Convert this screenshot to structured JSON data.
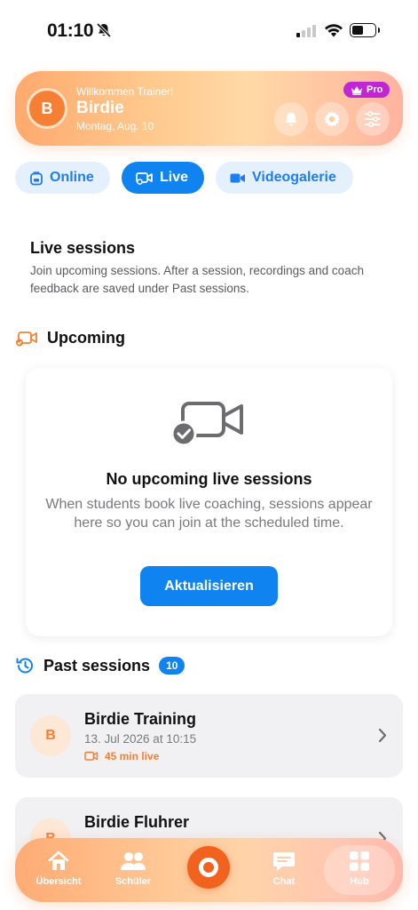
{
  "status_bar": {
    "time": "01:10"
  },
  "header": {
    "avatar_letter": "B",
    "welcome": "Willkommen Trainer!",
    "name": "Birdie",
    "date": "Montag, Aug. 10",
    "pro_badge": "Pro"
  },
  "tabs": [
    {
      "label": "Online",
      "active": false
    },
    {
      "label": "Live",
      "active": true
    },
    {
      "label": "Videogalerie",
      "active": false
    }
  ],
  "live_sessions": {
    "title": "Live sessions",
    "description": "Join upcoming sessions. After a session, recordings and coach feedback are saved under Past sessions."
  },
  "upcoming": {
    "title": "Upcoming",
    "empty_title": "No upcoming live sessions",
    "empty_desc": "When students book live coaching, sessions appear here so you can join at the scheduled time.",
    "refresh_label": "Aktualisieren"
  },
  "past": {
    "title": "Past sessions",
    "count": "10",
    "items": [
      {
        "avatar": "B",
        "title": "Birdie Training",
        "date": "13. Jul 2026 at 10:15",
        "live": "45 min live"
      },
      {
        "avatar": "B",
        "title": "Birdie Fluhrer"
      }
    ]
  },
  "bottom_nav": [
    {
      "label": "Übersicht",
      "icon": "home-icon"
    },
    {
      "label": "Schüler",
      "icon": "people-icon"
    },
    {
      "label": "",
      "icon": "record-icon"
    },
    {
      "label": "Chat",
      "icon": "chat-icon"
    },
    {
      "label": "Hub",
      "icon": "grid-icon",
      "active": true
    }
  ],
  "colors": {
    "accent": "#0f84f1",
    "brand_orange": "#f58035",
    "pro": "#c026d3"
  }
}
